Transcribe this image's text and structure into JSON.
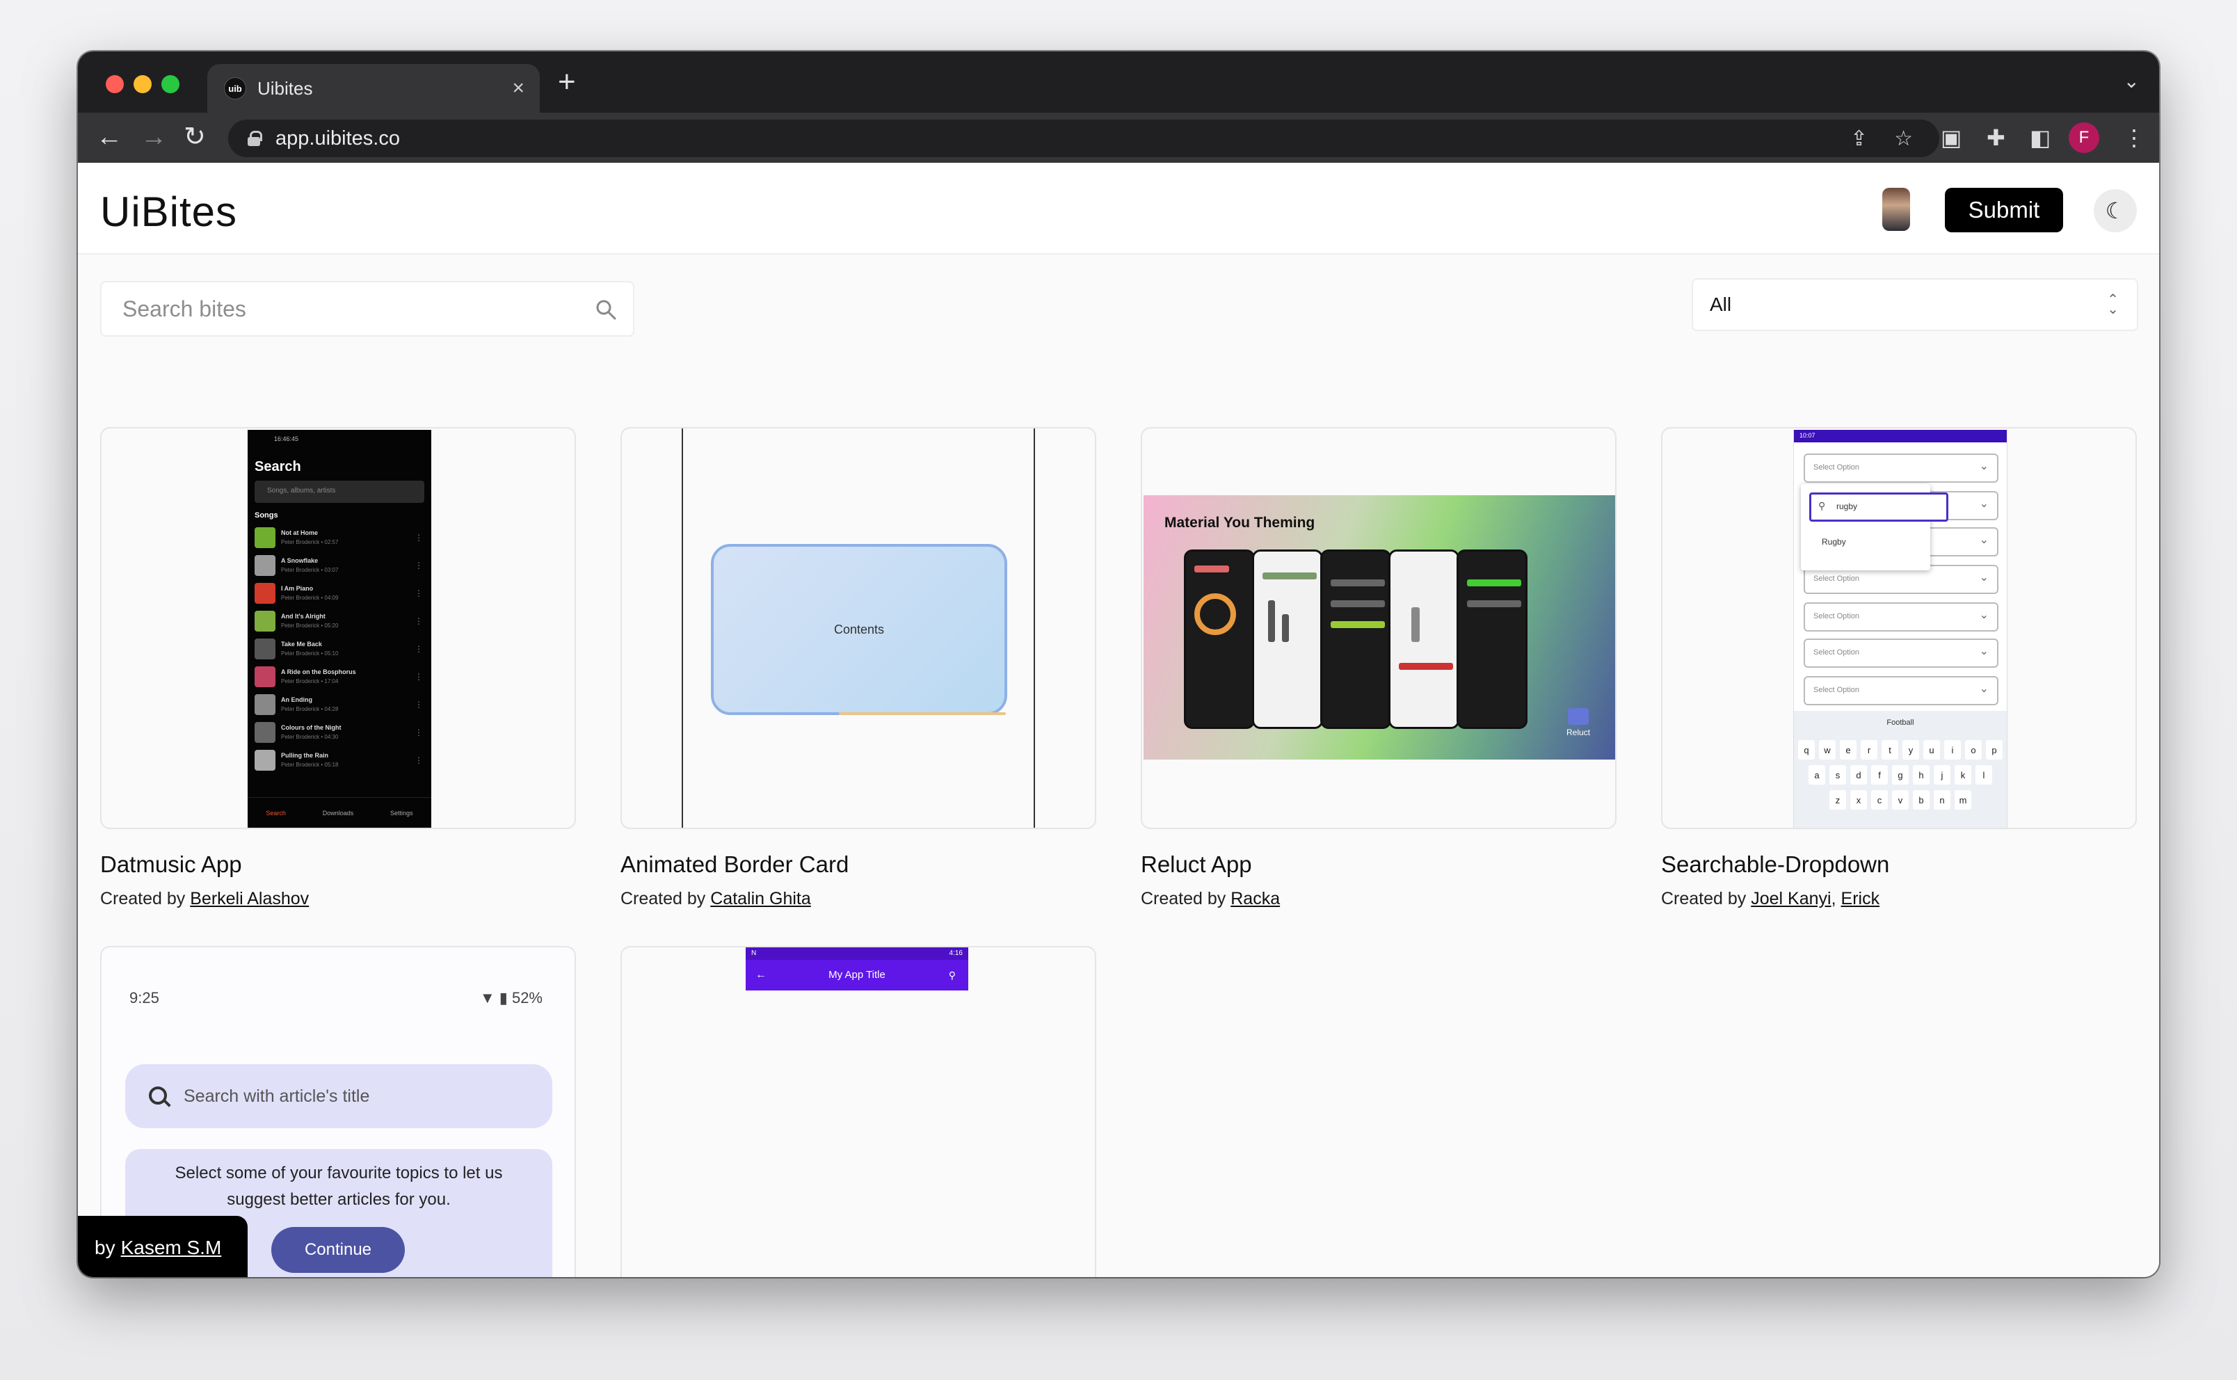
{
  "browser": {
    "tab_title": "Uibites",
    "tab_favicon": "uib",
    "url": "app.uibites.co",
    "profile_initial": "F"
  },
  "header": {
    "logo": "UiBites",
    "submit_label": "Submit"
  },
  "search": {
    "placeholder": "Search bites"
  },
  "filter": {
    "selected": "All"
  },
  "cards": [
    {
      "title": "Datmusic App",
      "created_by": "Created by",
      "authors": [
        "Berkeli Alashov"
      ]
    },
    {
      "title": "Animated Border Card",
      "created_by": "Created by",
      "authors": [
        "Catalin Ghita"
      ]
    },
    {
      "title": "Reluct App",
      "created_by": "Created by",
      "authors": [
        "Racka"
      ]
    },
    {
      "title": "Searchable-Dropdown",
      "created_by": "Created by",
      "authors": [
        "Joel Kanyi",
        "Erick"
      ]
    }
  ],
  "datmusic_preview": {
    "status": "16:46:45",
    "title": "Search",
    "search_placeholder": "Songs, albums, artists",
    "section": "Songs",
    "songs": [
      {
        "name": "Not at Home",
        "meta": "Peter Broderick • 02:57",
        "color": "#6fae2f"
      },
      {
        "name": "A Snowflake",
        "meta": "Peter Broderick • 03:07",
        "color": "#9a9a9a"
      },
      {
        "name": "I Am Piano",
        "meta": "Peter Broderick • 04:09",
        "color": "#d23a2a"
      },
      {
        "name": "And It's Alright",
        "meta": "Peter Broderick • 05:20",
        "color": "#7fae3f"
      },
      {
        "name": "Take Me Back",
        "meta": "Peter Broderick • 05:10",
        "color": "#555555"
      },
      {
        "name": "A Ride on the Bosphorus",
        "meta": "Peter Broderick • 17:04",
        "color": "#c04060"
      },
      {
        "name": "An Ending",
        "meta": "Peter Broderick • 04:28",
        "color": "#888888"
      },
      {
        "name": "Colours of the Night",
        "meta": "Peter Broderick • 04:30",
        "color": "#666666"
      },
      {
        "name": "Pulling the Rain",
        "meta": "Peter Broderick • 05:18",
        "color": "#aaaaaa"
      }
    ],
    "nav": [
      "Search",
      "Downloads",
      "Settings"
    ]
  },
  "border_card_preview": {
    "label": "Contents"
  },
  "reluct_preview": {
    "title": "Material You Theming",
    "brand": "Reluct"
  },
  "dropdown_preview": {
    "status": "10:07",
    "field_label": "Select Option",
    "query": "rugby",
    "option": "Rugby",
    "suggestion": "Football",
    "keys_row1": [
      "q",
      "w",
      "e",
      "r",
      "t",
      "y",
      "u",
      "i",
      "o",
      "p"
    ],
    "keys_row2": [
      "a",
      "s",
      "d",
      "f",
      "g",
      "h",
      "j",
      "k",
      "l"
    ],
    "keys_row3": [
      "z",
      "x",
      "c",
      "v",
      "b",
      "n",
      "m"
    ]
  },
  "article_preview": {
    "time": "9:25",
    "battery": "52%",
    "search_placeholder": "Search with article's title",
    "prompt": "Select some of your favourite topics to let us suggest better articles for you.",
    "button": "Continue"
  },
  "appbar_preview": {
    "title": "My App Title",
    "status_left": "N",
    "status_right": "4:16"
  },
  "byline": {
    "prefix": "by",
    "author": "Kasem S.M"
  },
  "colors": {
    "accent": "#000000",
    "reluct_gradient_start": "#f3b3d0",
    "dropdown_accent": "#4b2ec9",
    "article_accent": "#4d53a3",
    "appbar_accent": "#5f17e8"
  }
}
